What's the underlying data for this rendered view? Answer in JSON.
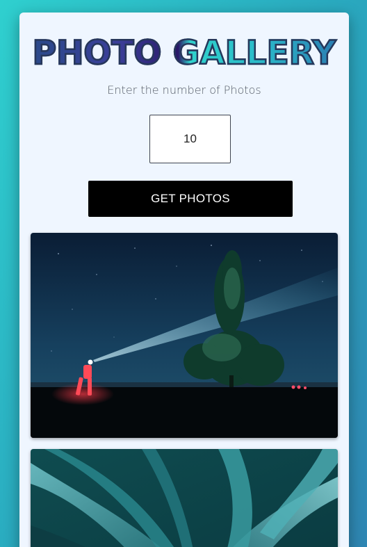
{
  "app": {
    "title": "PHOTO GALLERY",
    "subtitle": "Enter the number of Photos"
  },
  "form": {
    "count_value": "10",
    "button_label": "GET PHOTOS"
  },
  "gallery": {
    "photos": [
      {
        "subject": "night-sky-person-headlamp-tree"
      },
      {
        "subject": "agave-leaves-closeup"
      }
    ]
  },
  "colors": {
    "background_start": "#2fd0cf",
    "background_end": "#2f86b3",
    "card": "#eff6ff",
    "button": "#000000",
    "title_stroke": "#27375a"
  }
}
